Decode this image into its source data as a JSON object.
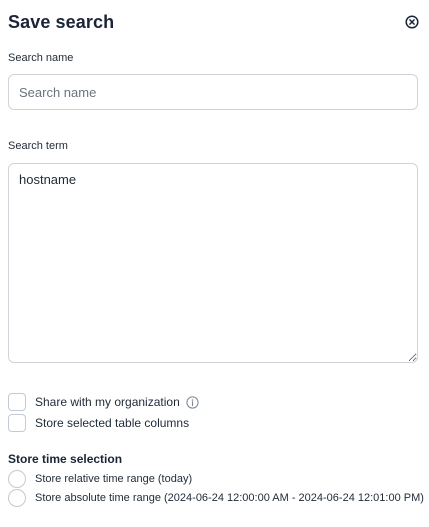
{
  "dialog": {
    "title": "Save search",
    "close_icon": "close-circle-icon"
  },
  "search_name": {
    "label": "Search name",
    "placeholder": "Search name",
    "value": ""
  },
  "search_term": {
    "label": "Search term",
    "value": "hostname"
  },
  "options": {
    "share_label": "Share with my organization",
    "share_checked": false,
    "info_icon": "info-icon",
    "columns_label": "Store selected table columns",
    "columns_checked": false
  },
  "time_selection": {
    "title": "Store time selection",
    "relative_label": "Store relative time range (today)",
    "absolute_label": "Store absolute time range (2024-06-24 12:00:00 AM - 2024-06-24 12:01:00 PM)"
  }
}
